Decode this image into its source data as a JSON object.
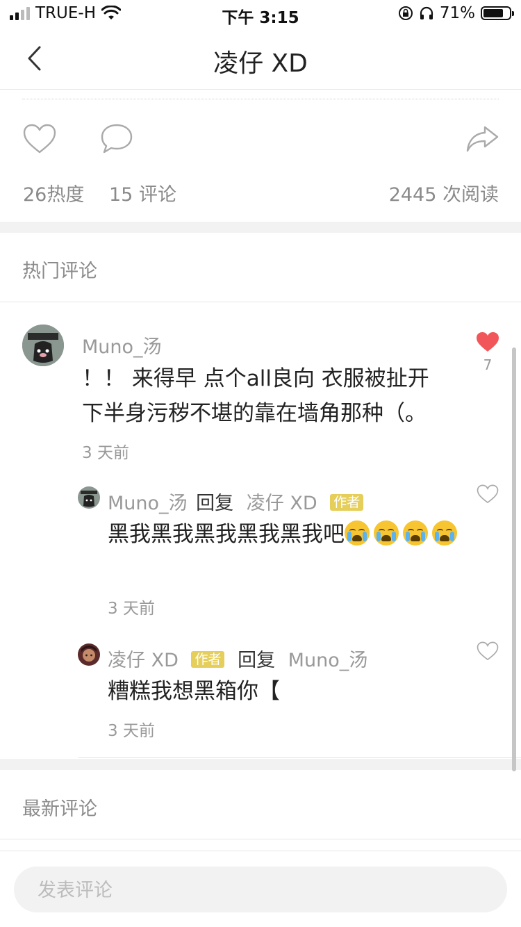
{
  "status_bar": {
    "carrier": "TRUE-H",
    "time": "下午 3:15",
    "battery": "71%"
  },
  "nav": {
    "title": "凌仔 XD"
  },
  "post_stats": {
    "heat": "26热度",
    "comments": "15 评论",
    "reads": "2445 次阅读"
  },
  "hot_comments": {
    "title": "热门评论",
    "comment": {
      "user": "Muno_汤",
      "text_line1": "！！ 来得早 点个all良向 衣服被扯开",
      "text_line2": "下半身污秽不堪的靠在墙角那种（。",
      "time": "3 天前",
      "likes": "7",
      "liked": true
    },
    "replies": [
      {
        "from": "Muno_汤",
        "reply_word": "回复",
        "to": "凌仔 XD",
        "to_tag": "作者",
        "text": "黑我黑我黑我黑我黑我吧",
        "emoji": "loudly-crying-face",
        "time": "3 天前"
      },
      {
        "from": "凌仔 XD",
        "from_tag": "作者",
        "reply_word": "回复",
        "to": "Muno_汤",
        "text": "糟糕我想黑箱你【",
        "time": "3 天前"
      }
    ]
  },
  "latest_comments": {
    "title": "最新评论"
  },
  "comment_input": {
    "placeholder": "发表评论"
  },
  "colors": {
    "accent_red": "#f0565a",
    "author_tag": "#e5cf5a",
    "muted_text": "#999999",
    "gap_bg": "#f2f2f2"
  }
}
